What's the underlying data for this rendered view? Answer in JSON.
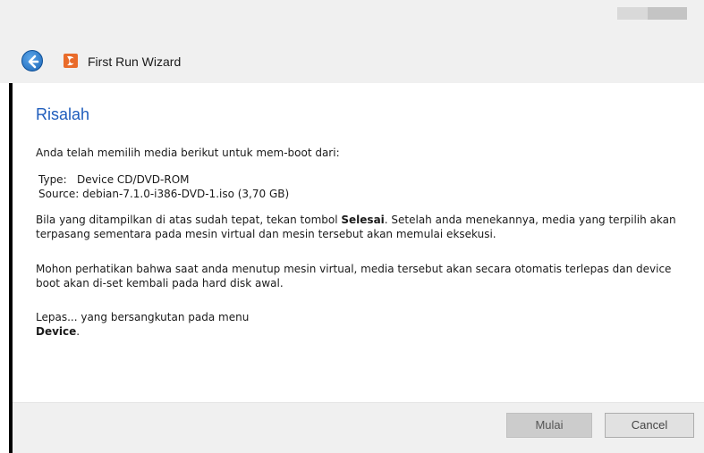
{
  "window": {
    "title": "First Run Wizard"
  },
  "page": {
    "heading": "Risalah",
    "intro": "Anda telah memilih media berikut untuk mem-boot dari:",
    "type_line": "Type:   Device CD/DVD-ROM",
    "source_line": "Source: debian-7.1.0-i386-DVD-1.iso (3,70 GB)",
    "info_before": "Bila yang ditampilkan di atas sudah tepat, tekan tombol ",
    "info_bold": "Selesai",
    "info_after": ". Setelah anda menekannya, media yang terpilih akan terpasang sementara pada mesin virtual dan mesin tersebut akan memulai eksekusi.",
    "note": "Mohon perhatikan bahwa saat anda menutup mesin virtual, media tersebut akan secara otomatis terlepas dan device boot akan di-set kembali pada hard disk awal.",
    "unmount_line": "Lepas... yang bersangkutan pada menu",
    "device_bold": "Device",
    "device_after": "."
  },
  "buttons": {
    "start": "Mulai",
    "cancel": "Cancel"
  },
  "icons": {
    "back": "back-arrow-icon",
    "app": "virtualbox-icon"
  },
  "colors": {
    "heading": "#1f5dbc",
    "back_button": "#1c67b8"
  }
}
